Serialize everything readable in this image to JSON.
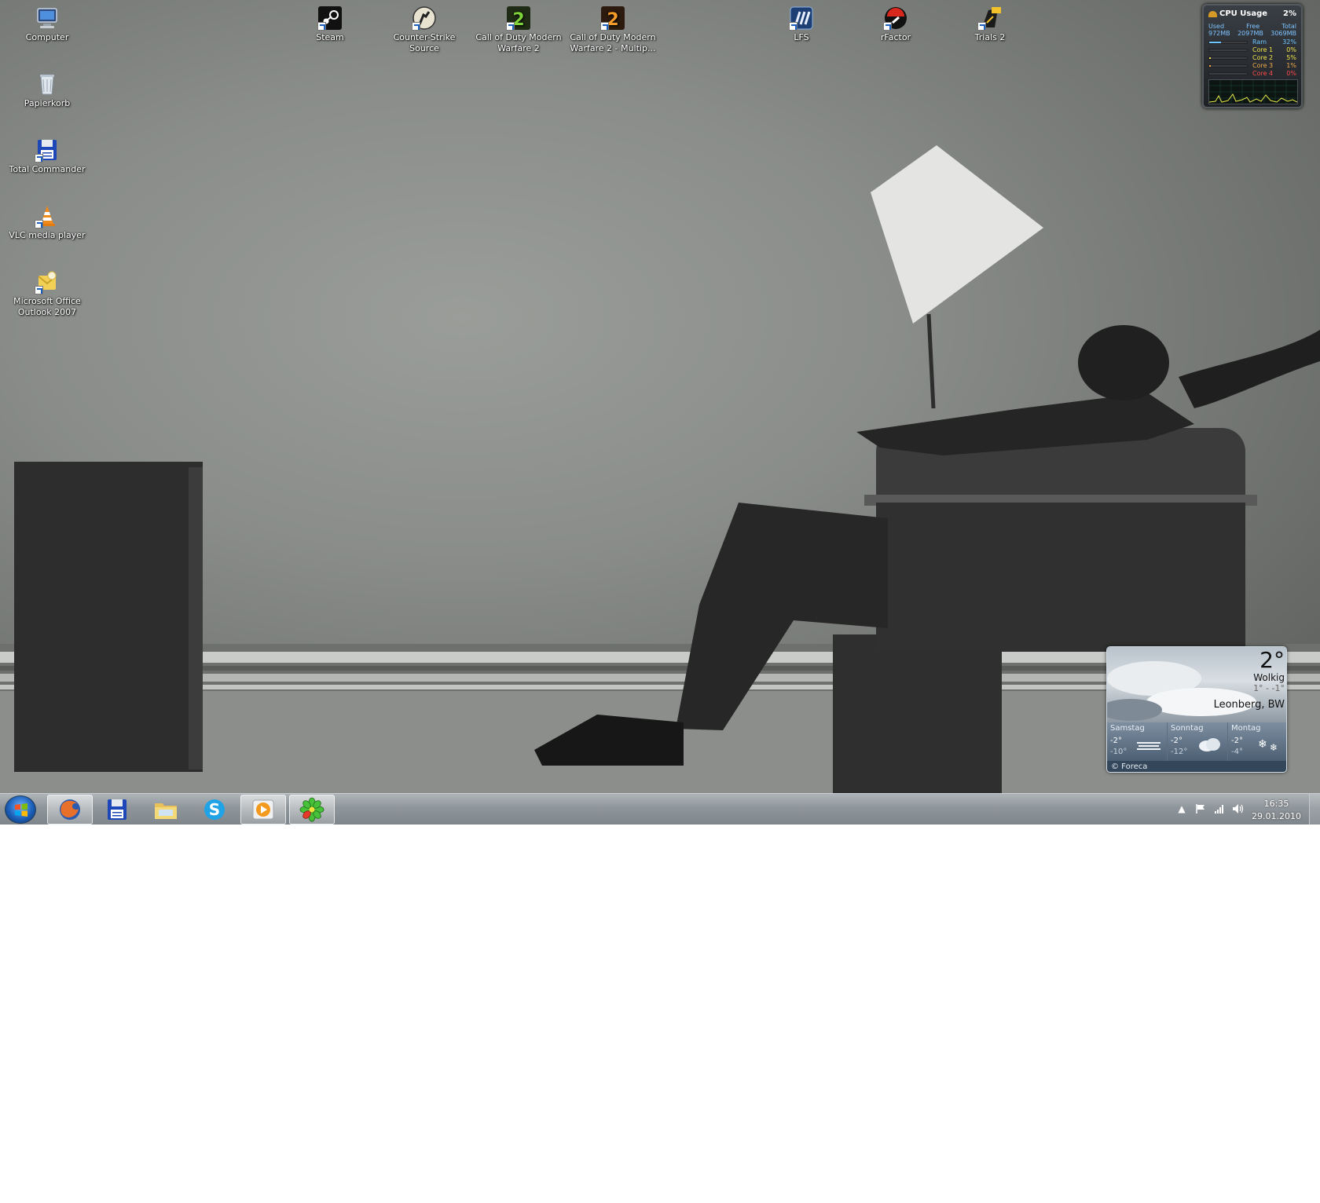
{
  "desktop": {
    "icons": [
      {
        "label": "Computer",
        "icon": "computer-icon"
      },
      {
        "label": "Papierkorb",
        "icon": "recycle-bin-icon"
      },
      {
        "label": "Total Commander",
        "icon": "floppy-disk-icon"
      },
      {
        "label": "VLC media player",
        "icon": "traffic-cone-icon"
      },
      {
        "label": "Microsoft Office Outlook 2007",
        "icon": "outlook-icon"
      },
      {
        "label": "Steam",
        "icon": "steam-icon"
      },
      {
        "label": "Counter-Strike Source",
        "icon": "counter-strike-icon"
      },
      {
        "label": "Call of Duty Modern Warfare 2",
        "icon": "cod-mw2-icon"
      },
      {
        "label": "Call of Duty Modern Warfare 2 - Multip...",
        "icon": "cod-mw2-mp-icon"
      },
      {
        "label": "LFS",
        "icon": "lfs-icon"
      },
      {
        "label": "rFactor",
        "icon": "rfactor-icon"
      },
      {
        "label": "Trials 2",
        "icon": "trials-icon"
      }
    ]
  },
  "cpu_gadget": {
    "title": "CPU Usage",
    "total_pct": "2%",
    "mem_headers": [
      "Used",
      "Free",
      "Total"
    ],
    "mem_values": [
      "972MB",
      "2097MB",
      "3069MB"
    ],
    "rows": [
      {
        "name": "Ram",
        "value": "32%",
        "fraction": 0.32,
        "color": "#6ec6ff"
      },
      {
        "name": "Core 1",
        "value": "0%",
        "fraction": 0.0,
        "color": "#f1e34a"
      },
      {
        "name": "Core 2",
        "value": "5%",
        "fraction": 0.05,
        "color": "#f1e34a"
      },
      {
        "name": "Core 3",
        "value": "1%",
        "fraction": 0.01,
        "color": "#f1a94a"
      },
      {
        "name": "Core 4",
        "value": "0%",
        "fraction": 0.0,
        "color": "#ff4a4a"
      }
    ]
  },
  "weather": {
    "temp": "2°",
    "condition": "Wolkig",
    "range": "1° - -1°",
    "location": "Leonberg, BW",
    "forecast": [
      {
        "day": "Samstag",
        "hi": "-2°",
        "lo": "-10°",
        "icon": "fog-icon"
      },
      {
        "day": "Sonntag",
        "hi": "-2°",
        "lo": "-12°",
        "icon": "cloud-icon"
      },
      {
        "day": "Montag",
        "hi": "-2°",
        "lo": "-4°",
        "icon": "snow-icon"
      }
    ],
    "source": "© Foreca"
  },
  "taskbar": {
    "items": [
      {
        "name": "firefox",
        "icon": "firefox-icon",
        "active": true
      },
      {
        "name": "total-commander",
        "icon": "floppy-disk-icon",
        "active": false
      },
      {
        "name": "explorer",
        "icon": "folder-icon",
        "active": false
      },
      {
        "name": "skype",
        "icon": "skype-icon",
        "active": false
      },
      {
        "name": "media-player",
        "icon": "media-player-icon",
        "active": true
      },
      {
        "name": "icq",
        "icon": "icq-flower-icon",
        "active": true
      }
    ],
    "clock_time": "16:35",
    "clock_date": "29.01.2010"
  }
}
